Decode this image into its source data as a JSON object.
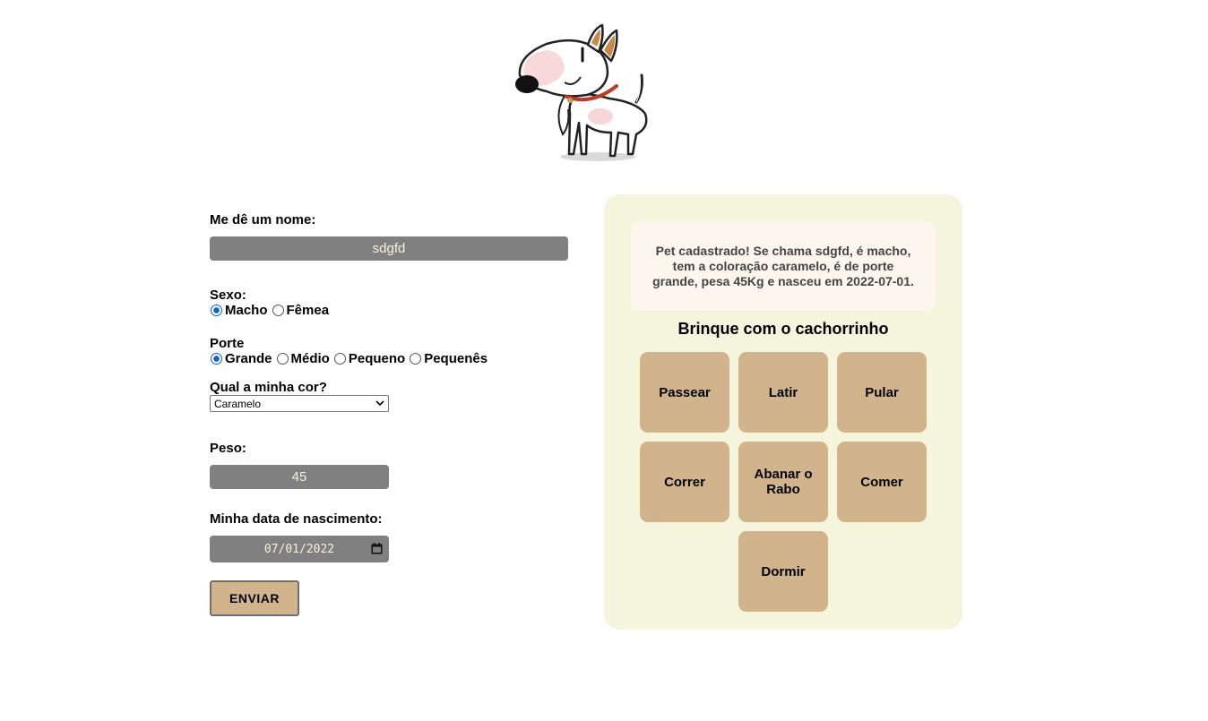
{
  "form": {
    "name_label": "Me dê um nome:",
    "name_value": "sdgfd",
    "sex_label": "Sexo:",
    "sex_options": [
      "Macho",
      "Fêmea"
    ],
    "sex_selected": "Macho",
    "size_label": "Porte",
    "size_options": [
      "Grande",
      "Médio",
      "Pequeno",
      "Pequenês"
    ],
    "size_selected": "Grande",
    "color_label": "Qual a minha cor?",
    "color_value": "Caramelo",
    "weight_label": "Peso:",
    "weight_value": "45",
    "birth_label": "Minha data de nascimento:",
    "birth_value": "07/01/2022",
    "submit_label": "ENVIAR"
  },
  "panel": {
    "message": "Pet cadastrado! Se chama sdgfd, é macho, tem a coloração caramelo, é de porte grande, pesa 45Kg e nasceu em 2022-07-01.",
    "play_title": "Brinque com o cachorrinho",
    "actions": [
      "Passear",
      "Latir",
      "Pular",
      "Correr",
      "Abanar o Rabo",
      "Comer",
      "Dormir"
    ]
  },
  "icons": {
    "mascot": "bull-terrier-dog-illustration",
    "select_arrow": "chevron-down-icon",
    "date_picker": "calendar-icon"
  },
  "colors": {
    "input_bg": "#808080",
    "input_text": "#f7f1dc",
    "button_tan": "#d2b48c",
    "panel_bg": "#f5f4dc",
    "message_bg": "#fdf6ee",
    "radio_accent": "#0a63d6"
  }
}
